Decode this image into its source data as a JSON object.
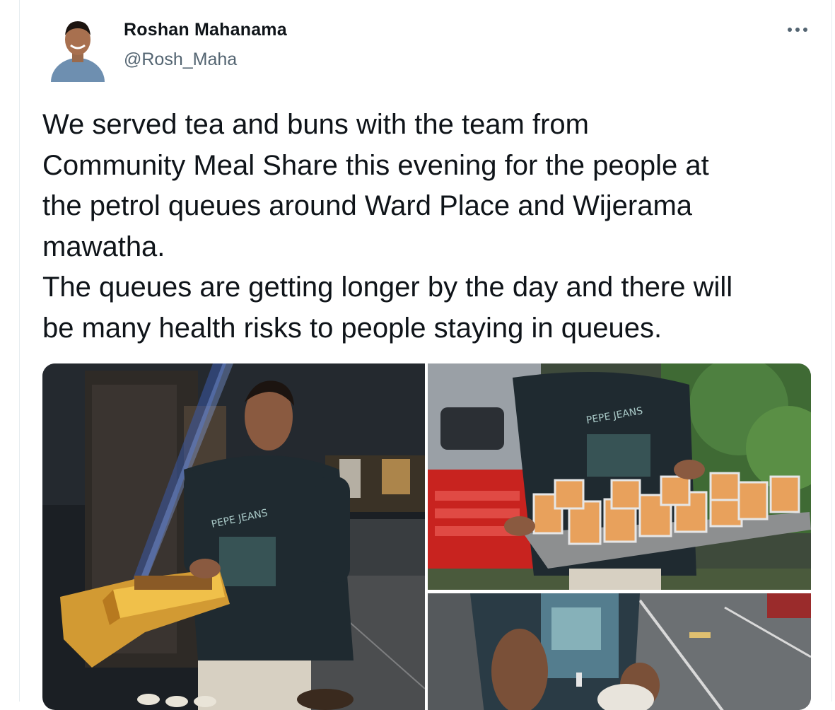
{
  "tweet": {
    "author": {
      "name": "Roshan Mahanama",
      "handle": "@Rosh_Maha",
      "avatar_icon": "avatar-photo"
    },
    "more_icon": "more-horizontal-icon",
    "text": "We served tea and buns with the team from\nCommunity Meal Share this evening for the people at\nthe petrol queues around Ward Place and Wijerama\nmawatha.\nThe queues are getting longer by the day and there will\nbe many health risks to people staying in queues.",
    "media": {
      "photo_count": 3,
      "colors": {
        "night_bg": "#1b1f24",
        "shirt": "#1f2a30",
        "tea": "#e8a15c",
        "gold_box": "#d29a33",
        "tuk_tuk_red": "#c8231f"
      }
    }
  }
}
